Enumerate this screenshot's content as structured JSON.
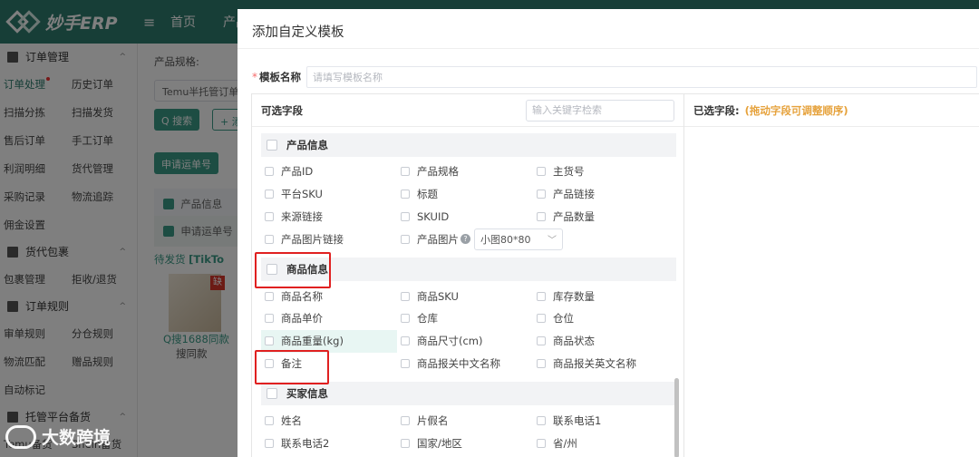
{
  "app": {
    "logo_text": "妙手ERP",
    "menu_icon": "≡",
    "top_nav": [
      "首页",
      "产品"
    ]
  },
  "sidebar": {
    "groups": [
      {
        "label": "订单管理",
        "icon": "order-icon",
        "rows": [
          [
            "订单处理",
            "历史订单"
          ],
          [
            "扫描分拣",
            "扫描发货"
          ],
          [
            "售后订单",
            "手工订单"
          ],
          [
            "利润明细",
            "货代管理"
          ],
          [
            "采购记录",
            "物流追踪"
          ],
          [
            "佣金设置",
            ""
          ]
        ]
      },
      {
        "label": "货代包裹",
        "icon": "package-icon",
        "rows": [
          [
            "包裹管理",
            "拒收/退货"
          ]
        ]
      },
      {
        "label": "订单规则",
        "icon": "rule-icon",
        "rows": [
          [
            "审单规则",
            "分仓规则"
          ],
          [
            "物流匹配",
            "赠品规则"
          ],
          [
            "自动标记",
            ""
          ]
        ]
      },
      {
        "label": "托管平台备货",
        "icon": "stock-icon",
        "rows": [
          [
            "Temu备货",
            "Shein备货"
          ]
        ]
      }
    ]
  },
  "background": {
    "filter_label": "产品规格:",
    "filter_value": "Temu半托管订单",
    "search_btn": "搜索",
    "add_btn": "+ 添",
    "apply_btn": "申请运单号",
    "table_header": "产品信息",
    "row_label": "申请运单号",
    "status": "待发货",
    "platform": "[TikTo",
    "link_text": "Q搜1688同款",
    "similar_text": "搜同款",
    "badge": "缺"
  },
  "modal": {
    "title": "添加自定义模板",
    "name_label": "模板名称",
    "name_placeholder": "请填写模板名称",
    "available_title": "可选字段",
    "search_placeholder": "输入关键字检索",
    "selected_title": "已选字段:",
    "selected_hint": "(拖动字段可调整顺序)",
    "groups": [
      {
        "title": "产品信息",
        "fields": [
          "产品ID",
          "产品规格",
          "主货号",
          "平台SKU",
          "标题",
          "产品链接",
          "来源链接",
          "SKUID",
          "产品数量",
          "产品图片链接",
          "产品图片",
          ""
        ]
      },
      {
        "title": "商品信息",
        "fields": [
          "商品名称",
          "商品SKU",
          "库存数量",
          "商品单价",
          "仓库",
          "仓位",
          "商品重量(kg)",
          "商品尺寸(cm)",
          "商品状态",
          "备注",
          "商品报关中文名称",
          "商品报关英文名称"
        ]
      },
      {
        "title": "买家信息",
        "fields": [
          "姓名",
          "片假名",
          "联系电话1",
          "联系电话2",
          "国家/地区",
          "省/州"
        ]
      }
    ],
    "image_size": {
      "selected": "小图80*80"
    }
  },
  "watermark": "大数跨境",
  "colors": {
    "brand": "#2f7d6f",
    "accent": "#3a9a86",
    "hint": "#e6a23c",
    "highlight_box": "#e02020"
  }
}
